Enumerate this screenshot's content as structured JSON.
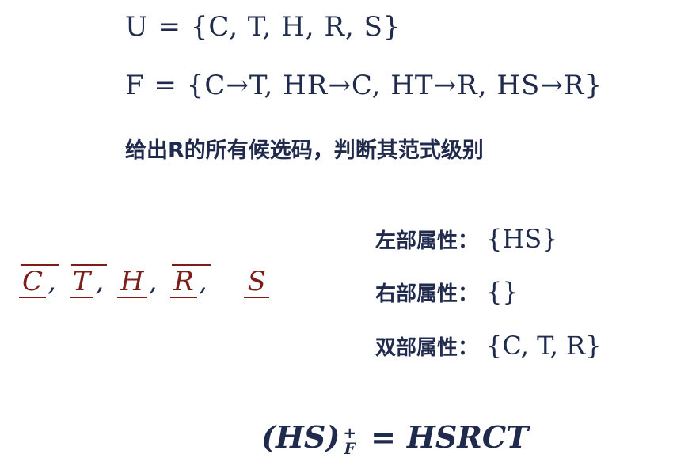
{
  "universe": {
    "text": "U  =  {C, T, H, R, S}"
  },
  "dependencies": {
    "text": "F  =  {C→T, HR→C, HT→R, HS→R}"
  },
  "instruction": "给出R的所有候选码，判断其范式级别",
  "attribute_list": [
    {
      "letter": "C",
      "separator": ",",
      "overline": true
    },
    {
      "letter": "T",
      "separator": ",",
      "overline": true
    },
    {
      "letter": "H",
      "separator": ",",
      "overline": false
    },
    {
      "letter": "R",
      "separator": ",",
      "overline": true
    },
    {
      "letter": "S",
      "separator": "",
      "overline": false
    }
  ],
  "attribute_types": [
    {
      "label": "左部属性：",
      "value": "{HS}"
    },
    {
      "label": "右部属性：",
      "value": "{}"
    },
    {
      "label": "双部属性：",
      "value": "{C, T, R}"
    }
  ],
  "closure": {
    "left": "(HS)",
    "superscript": "+",
    "subscript": "F",
    "equals": "=",
    "right": "HSRCT"
  },
  "colors": {
    "text": "#1f2a4d",
    "accent": "#7b1e1a"
  }
}
